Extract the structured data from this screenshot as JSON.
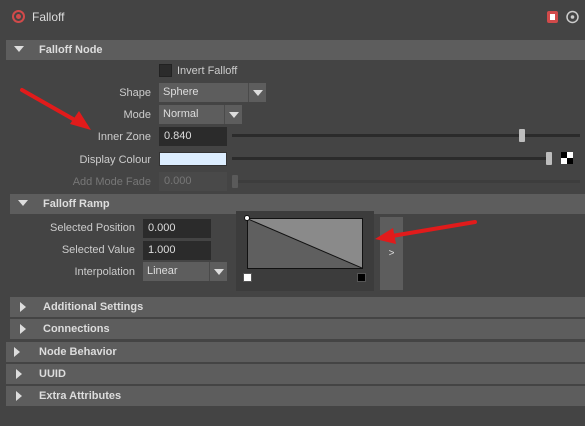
{
  "window": {
    "title": "Falloff"
  },
  "falloff_node": {
    "header": "Falloff Node",
    "invert_label": "Invert Falloff",
    "shape_label": "Shape",
    "shape_value": "Sphere",
    "mode_label": "Mode",
    "mode_value": "Normal",
    "inner_zone_label": "Inner Zone",
    "inner_zone_value": "0.840",
    "inner_zone_fraction": 0.84,
    "display_colour_label": "Display Colour",
    "display_colour": "#ddeeff",
    "add_mode_fade_label": "Add Mode Fade",
    "add_mode_fade_value": "0.000"
  },
  "falloff_ramp": {
    "header": "Falloff Ramp",
    "selected_position_label": "Selected Position",
    "selected_position_value": "0.000",
    "selected_value_label": "Selected Value",
    "selected_value_value": "1.000",
    "interpolation_label": "Interpolation",
    "interpolation_value": "Linear",
    "expand_label": ">"
  },
  "collapsed_sections": {
    "additional_settings": "Additional Settings",
    "connections": "Connections",
    "node_behavior": "Node Behavior",
    "uuid": "UUID",
    "extra_attributes": "Extra Attributes"
  },
  "colors": {
    "panel_bg": "#444444",
    "header_bg": "#5d5d5d",
    "field_bg": "#2b2b2b",
    "annotation_arrow": "#e11b1b",
    "logo": "#d14a4a"
  }
}
